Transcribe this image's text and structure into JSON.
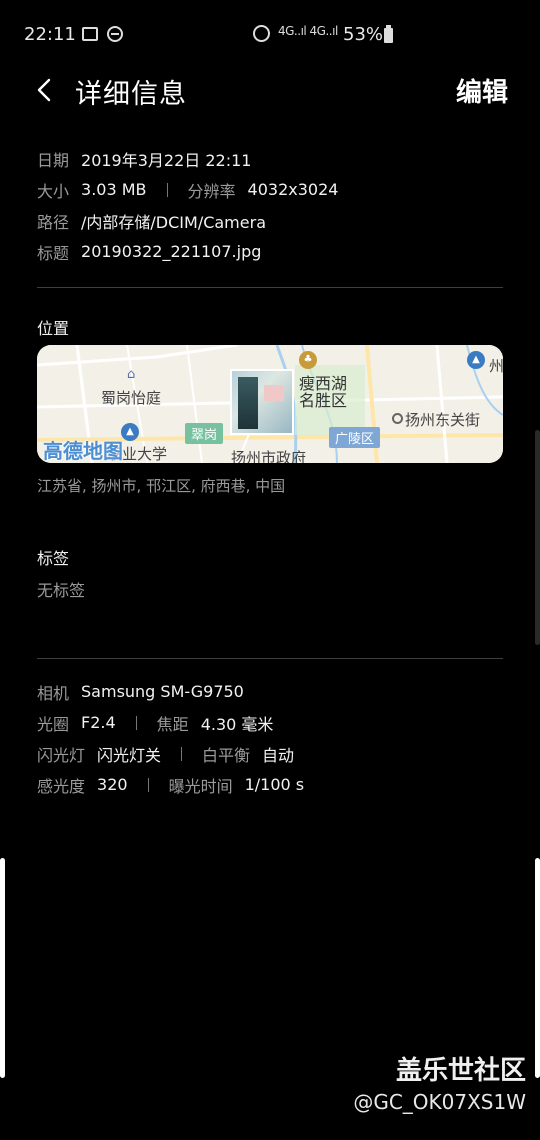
{
  "status_bar": {
    "time": "22:11",
    "signal_text": "4G..ıl 4G..ıl",
    "battery_percent": "53%",
    "icons": [
      "image-icon",
      "dnd-icon",
      "alarm-icon",
      "wifi-icon",
      "signal-icon",
      "battery-icon"
    ]
  },
  "header": {
    "title": "详细信息",
    "edit_label": "编辑",
    "back_icon": "chevron-left-icon"
  },
  "details": {
    "date_label": "日期",
    "date_value": "2019年3月22日 22:11",
    "size_label": "大小",
    "size_value": "3.03 MB",
    "resolution_label": "分辨率",
    "resolution_value": "4032x3024",
    "path_label": "路径",
    "path_value": "/内部存储/DCIM/Camera",
    "title_label": "标题",
    "title_value": "20190322_221107.jpg"
  },
  "location": {
    "section_title": "位置",
    "address": "江苏省, 扬州市, 邗江区, 府西巷, 中国",
    "map": {
      "labels": {
        "shuguang": "蜀岗怡庭",
        "shouxihu": "瘦西湖\n名胜区",
        "dongguan": "扬州东关街",
        "zhengfu": "扬州市政府",
        "daxue": "职业大学",
        "cuigang": "翠岗",
        "guangling": "广陵区",
        "zhou": "州",
        "logo": "高德地图"
      }
    }
  },
  "tags": {
    "section_title": "标签",
    "empty_text": "无标签"
  },
  "camera": {
    "camera_label": "相机",
    "camera_value": "Samsung SM-G9750",
    "aperture_label": "光圈",
    "aperture_value": "F2.4",
    "focal_label": "焦距",
    "focal_value": "4.30 毫米",
    "flash_label": "闪光灯",
    "flash_value": "闪光灯关",
    "wb_label": "白平衡",
    "wb_value": "自动",
    "iso_label": "感光度",
    "iso_value": "320",
    "exposure_label": "曝光时间",
    "exposure_value": "1/100 s"
  },
  "watermark": {
    "main": "盖乐世社区",
    "sub": "@GC_OK07XS1W"
  }
}
